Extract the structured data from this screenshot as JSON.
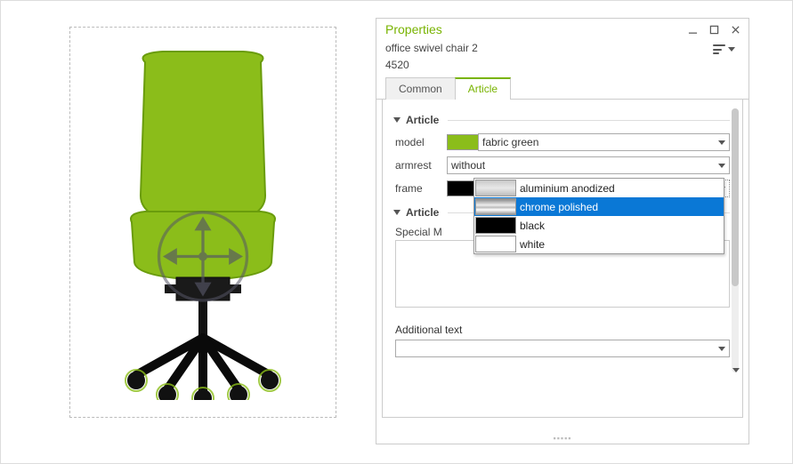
{
  "panel": {
    "title": "Properties",
    "object_name": "office swivel chair 2",
    "object_code": "4520"
  },
  "tabs": {
    "common": "Common",
    "article": "Article"
  },
  "sections": {
    "article_header": "Article",
    "article_header2": "Article"
  },
  "fields": {
    "model_label": "model",
    "model_value": "fabric green",
    "armrest_label": "armrest",
    "armrest_value": "without",
    "frame_label": "frame",
    "frame_value": "black",
    "special_label": "Special M",
    "additional_label": "Additional text",
    "additional_value": ""
  },
  "frame_options": [
    {
      "label": "aluminium anodized",
      "swatch": "alu",
      "selected": false
    },
    {
      "label": "chrome polished",
      "swatch": "chrome",
      "selected": true
    },
    {
      "label": "black",
      "swatch": "black",
      "selected": false
    },
    {
      "label": "white",
      "swatch": "white",
      "selected": false
    }
  ]
}
